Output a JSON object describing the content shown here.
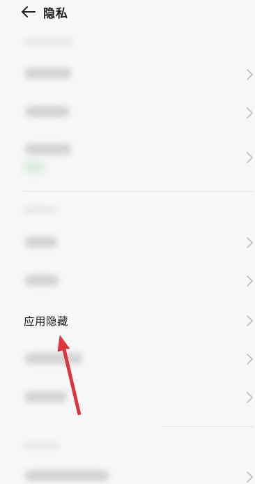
{
  "header": {
    "title": "隐私",
    "back_icon": "arrow-left-icon"
  },
  "highlighted_item": {
    "label": "应用隐藏"
  },
  "annotation": {
    "arrow_color": "#e0353b"
  },
  "colors": {
    "background": "#f7f7f7",
    "chevron": "#bdbdbd",
    "divider": "#e6e6e6"
  }
}
